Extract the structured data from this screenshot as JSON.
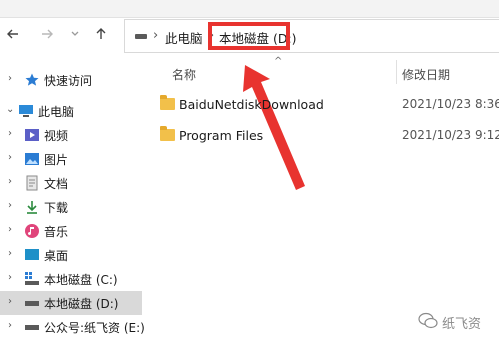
{
  "toolbar": {
    "back_icon": "arrow-left-icon",
    "forward_icon": "arrow-right-icon",
    "recent_icon": "chevron-down-icon",
    "up_icon": "arrow-up-icon"
  },
  "address_bar": {
    "crumbs": [
      "此电脑",
      "本地磁盘 (D:)"
    ],
    "separator": "›",
    "highlight_color": "#e8332f"
  },
  "sidebar": {
    "items": [
      {
        "label": "快速访问",
        "icon": "star-icon",
        "expanded": false
      },
      {
        "label": "此电脑",
        "icon": "computer-icon",
        "expanded": true
      },
      {
        "label": "视频",
        "icon": "video-icon"
      },
      {
        "label": "图片",
        "icon": "picture-icon"
      },
      {
        "label": "文档",
        "icon": "document-icon"
      },
      {
        "label": "下载",
        "icon": "download-icon"
      },
      {
        "label": "音乐",
        "icon": "music-icon"
      },
      {
        "label": "桌面",
        "icon": "desktop-icon"
      },
      {
        "label": "本地磁盘 (C:)",
        "icon": "system-drive-icon"
      },
      {
        "label": "本地磁盘 (D:)",
        "icon": "drive-icon",
        "selected": true
      },
      {
        "label": "公众号:纸飞资 (E:)",
        "icon": "drive-icon"
      }
    ],
    "chevron_right": "›",
    "chevron_down": "⌄"
  },
  "columns": {
    "name": "名称",
    "modified": "修改日期",
    "sort_indicator": "^"
  },
  "files": [
    {
      "name": "BaiduNetdiskDownload",
      "date": "2021/10/23 8:36",
      "icon": "folder-icon"
    },
    {
      "name": "Program Files",
      "date": "2021/10/23 9:12",
      "icon": "folder-icon"
    }
  ],
  "watermark": {
    "text": "纸飞资",
    "icon": "wechat-icon"
  },
  "colors": {
    "annotation_red": "#e8332f",
    "folder": "#f2c04a",
    "selection": "#d9d9d9"
  }
}
